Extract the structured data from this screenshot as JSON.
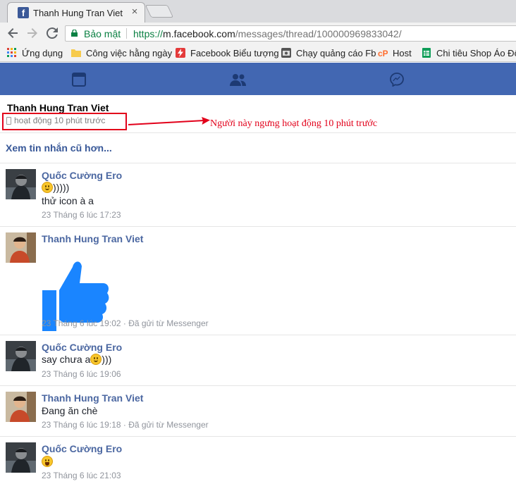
{
  "browser": {
    "tab_title": "Thanh Hung Tran Viet",
    "tab_close": "×",
    "secure_label": "Bảo mật",
    "url_scheme": "https://",
    "url_host": "m.facebook.com",
    "url_path": "/messages/thread/100000969833042/"
  },
  "bookmarks": [
    {
      "label": "Ứng dụng",
      "icon": "apps-grid-icon"
    },
    {
      "label": "Công việc hằng ngày",
      "icon": "folder-icon"
    },
    {
      "label": "Facebook Biểu tượng",
      "icon": "lightning-icon"
    },
    {
      "label": "Chạy quảng cáo Fb",
      "icon": "camera-icon"
    },
    {
      "label": "Host",
      "icon": "cpanel-icon"
    },
    {
      "label": "Chi tiêu Shop Áo Đôi",
      "icon": "sheets-icon"
    }
  ],
  "fb_nav": {
    "icons": [
      "feed-icon",
      "friends-icon",
      "messenger-icon"
    ],
    "color": "#4267b2"
  },
  "thread": {
    "name": "Thanh Hung Tran Viet",
    "active_status": "hoạt động 10 phút trước",
    "annotation": "Người này ngưng hoạt động 10 phút trước",
    "older_link": "Xem tin nhắn cũ hơn..."
  },
  "messages": [
    {
      "sender": "Quốc Cường Ero",
      "lines": [
        ")))))",
        "thử icon à a"
      ],
      "meta": "23 Tháng 6 lúc 17:23"
    },
    {
      "sender": "Thanh Hung Tran Viet",
      "sticker": "like-thumb-icon",
      "meta": "23 Tháng 6 lúc 19:02 · Đã gửi từ Messenger"
    },
    {
      "sender": "Quốc Cường Ero",
      "lines": [
        "say chưa a ",
        ")))"
      ],
      "meta": "23 Tháng 6 lúc 19:06"
    },
    {
      "sender": "Thanh Hung Tran Viet",
      "lines": [
        "Đang ăn chè"
      ],
      "meta": "23 Tháng 6 lúc 19:18 · Đã gửi từ Messenger"
    },
    {
      "sender": "Quốc Cường Ero",
      "meta": "23 Tháng 6 lúc 21:03"
    }
  ]
}
